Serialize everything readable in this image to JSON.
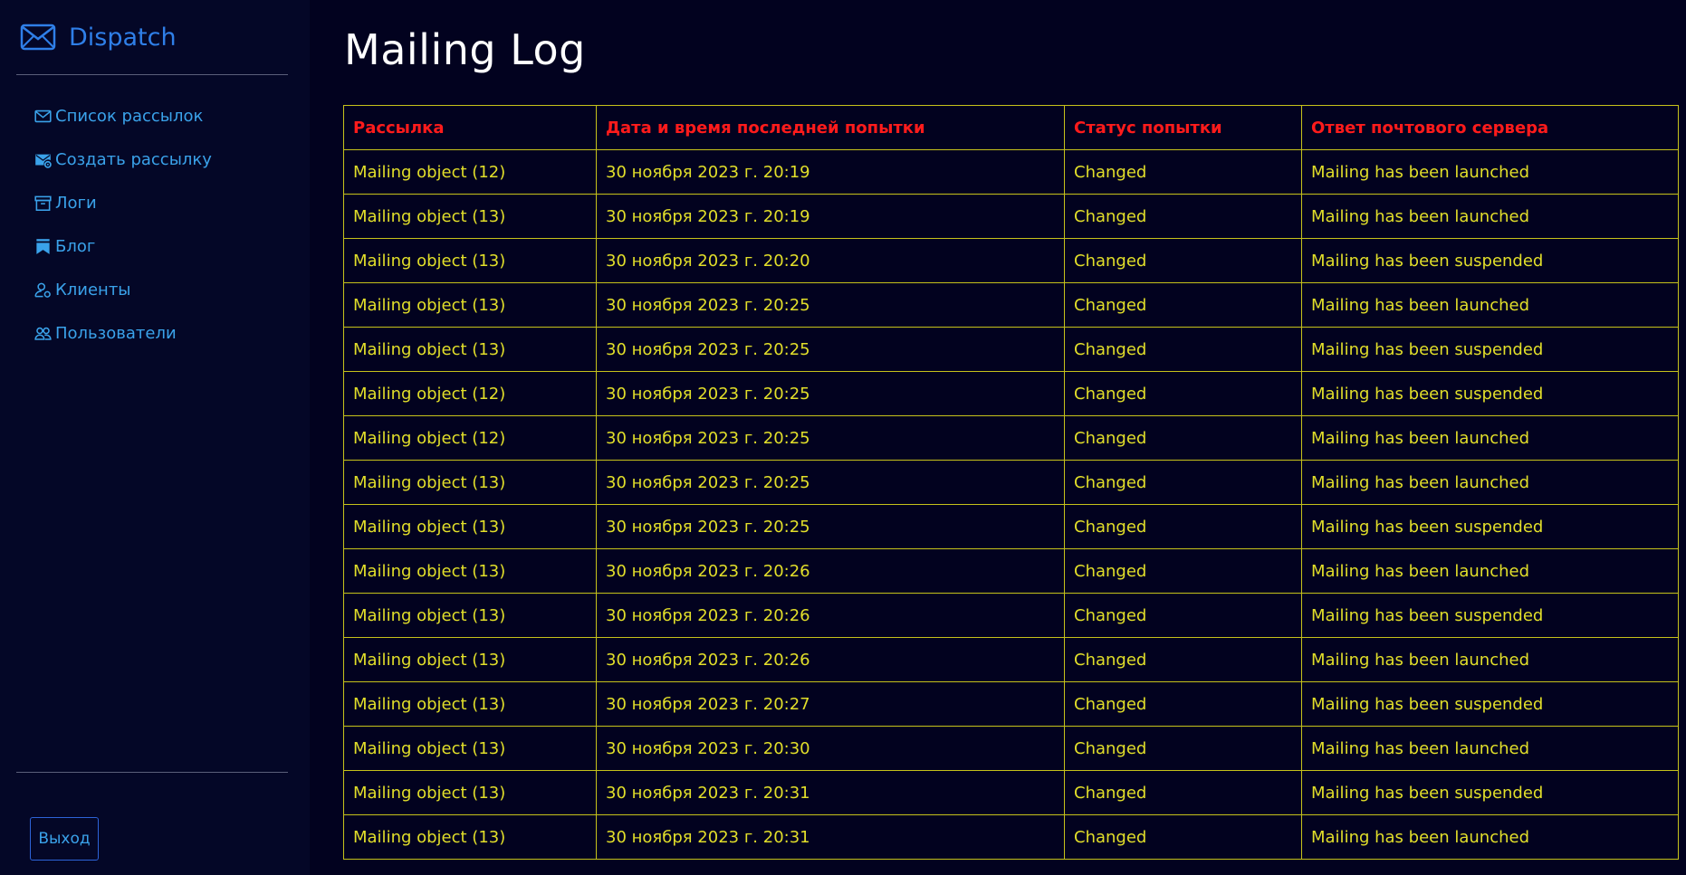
{
  "brand": {
    "name": "Dispatch",
    "icon": "envelope-icon"
  },
  "nav": [
    {
      "label": "Список рассылок",
      "icon": "envelope-icon"
    },
    {
      "label": "Создать рассылку",
      "icon": "envelope-gear-icon"
    },
    {
      "label": "Логи",
      "icon": "archive-icon"
    },
    {
      "label": "Блог",
      "icon": "bookmarks-icon"
    },
    {
      "label": "Клиенты",
      "icon": "person-gear-icon"
    },
    {
      "label": "Пользователи",
      "icon": "people-icon"
    }
  ],
  "logout_label": "Выход",
  "page_title": "Mailing Log",
  "table": {
    "headers": [
      "Рассылка",
      "Дата и время последней попытки",
      "Статус попытки",
      "Ответ почтового сервера"
    ],
    "rows": [
      [
        "Mailing object (12)",
        "30 ноября 2023 г. 20:19",
        "Changed",
        "Mailing has been launched"
      ],
      [
        "Mailing object (13)",
        "30 ноября 2023 г. 20:19",
        "Changed",
        "Mailing has been launched"
      ],
      [
        "Mailing object (13)",
        "30 ноября 2023 г. 20:20",
        "Changed",
        "Mailing has been suspended"
      ],
      [
        "Mailing object (13)",
        "30 ноября 2023 г. 20:25",
        "Changed",
        "Mailing has been launched"
      ],
      [
        "Mailing object (13)",
        "30 ноября 2023 г. 20:25",
        "Changed",
        "Mailing has been suspended"
      ],
      [
        "Mailing object (12)",
        "30 ноября 2023 г. 20:25",
        "Changed",
        "Mailing has been suspended"
      ],
      [
        "Mailing object (12)",
        "30 ноября 2023 г. 20:25",
        "Changed",
        "Mailing has been launched"
      ],
      [
        "Mailing object (13)",
        "30 ноября 2023 г. 20:25",
        "Changed",
        "Mailing has been launched"
      ],
      [
        "Mailing object (13)",
        "30 ноября 2023 г. 20:25",
        "Changed",
        "Mailing has been suspended"
      ],
      [
        "Mailing object (13)",
        "30 ноября 2023 г. 20:26",
        "Changed",
        "Mailing has been launched"
      ],
      [
        "Mailing object (13)",
        "30 ноября 2023 г. 20:26",
        "Changed",
        "Mailing has been suspended"
      ],
      [
        "Mailing object (13)",
        "30 ноября 2023 г. 20:26",
        "Changed",
        "Mailing has been launched"
      ],
      [
        "Mailing object (13)",
        "30 ноября 2023 г. 20:27",
        "Changed",
        "Mailing has been suspended"
      ],
      [
        "Mailing object (13)",
        "30 ноября 2023 г. 20:30",
        "Changed",
        "Mailing has been launched"
      ],
      [
        "Mailing object (13)",
        "30 ноября 2023 г. 20:31",
        "Changed",
        "Mailing has been suspended"
      ],
      [
        "Mailing object (13)",
        "30 ноября 2023 г. 20:31",
        "Changed",
        "Mailing has been launched"
      ]
    ]
  },
  "colors": {
    "background": "#02021f",
    "sidebar": "#040727",
    "accent": "#2f7fe8",
    "nav_text": "#3aa2ea",
    "header_text": "#ff1b1b",
    "cell_text": "#e2df2a",
    "border": "#c6c21b"
  }
}
